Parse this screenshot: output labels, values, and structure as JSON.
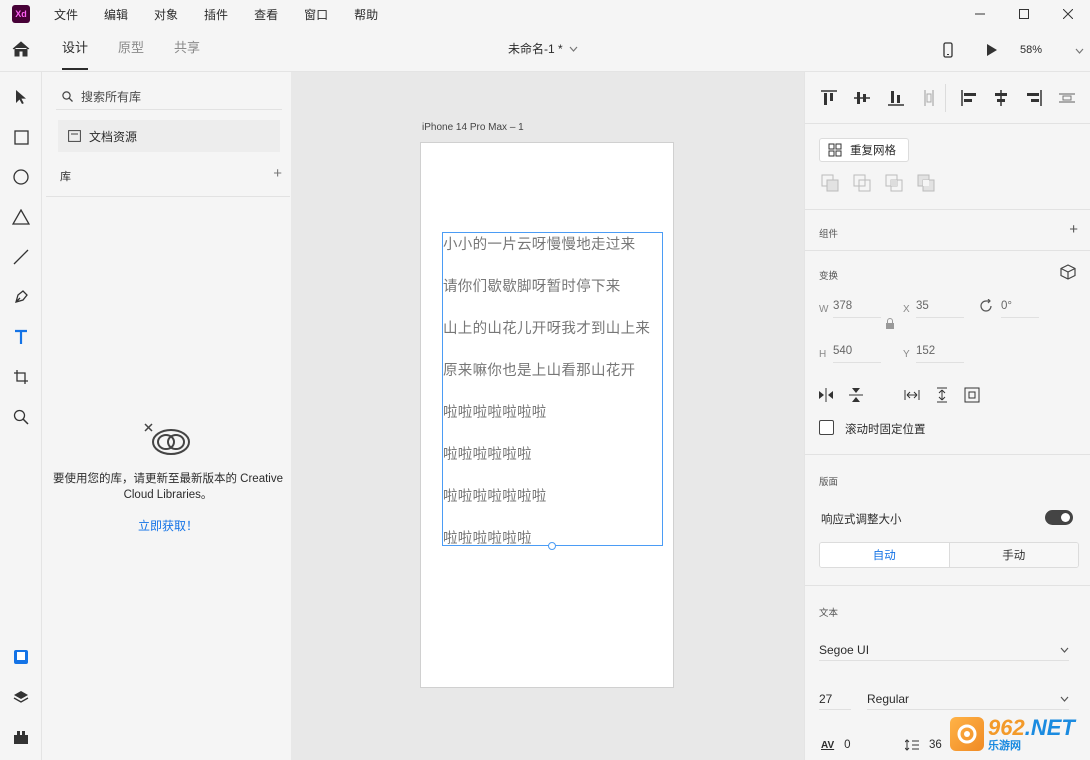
{
  "app": {
    "logo_text": "Xd"
  },
  "menu": [
    "文件",
    "编辑",
    "对象",
    "插件",
    "查看",
    "窗口",
    "帮助"
  ],
  "toolbar": {
    "tabs": [
      "设计",
      "原型",
      "共享"
    ],
    "doc_title": "未命名-1 *",
    "zoom": "58%"
  },
  "library": {
    "search_placeholder": "搜索所有库",
    "doc_assets": "文档资源",
    "section": "库",
    "empty_message_line1": "要使用您的库，请更新至最新版本的 Creative",
    "empty_message_line2": "Cloud Libraries。",
    "get_link": "立即获取！"
  },
  "canvas": {
    "artboard_label": "iPhone 14 Pro Max – 1",
    "text_lines": [
      "小小的一片云呀慢慢地走过来",
      "请你们歇歇脚呀暂时停下来",
      "山上的山花儿开呀我才到山上来",
      "原来嘛你也是上山看那山花开",
      "啦啦啦啦啦啦啦",
      "啦啦啦啦啦啦",
      "啦啦啦啦啦啦啦",
      "啦啦啦啦啦啦"
    ]
  },
  "props": {
    "repeat_grid": "重复网格",
    "component_label": "组件",
    "transform_label": "变换",
    "w_label": "W",
    "w_value": "378",
    "x_label": "X",
    "x_value": "35",
    "h_label": "H",
    "h_value": "540",
    "y_label": "Y",
    "y_value": "152",
    "rotation": "0°",
    "fix_position": "滚动时固定位置",
    "layout_label": "版面",
    "responsive_resize": "响应式调整大小",
    "auto": "自动",
    "manual": "手动",
    "text_label": "文本",
    "font_family": "Segoe UI",
    "font_size": "27",
    "font_weight": "Regular",
    "char_spacing": "0",
    "line_spacing": "36"
  },
  "watermark": {
    "number_a": "962",
    "number_b": ".NET",
    "subtitle": "乐游网"
  }
}
